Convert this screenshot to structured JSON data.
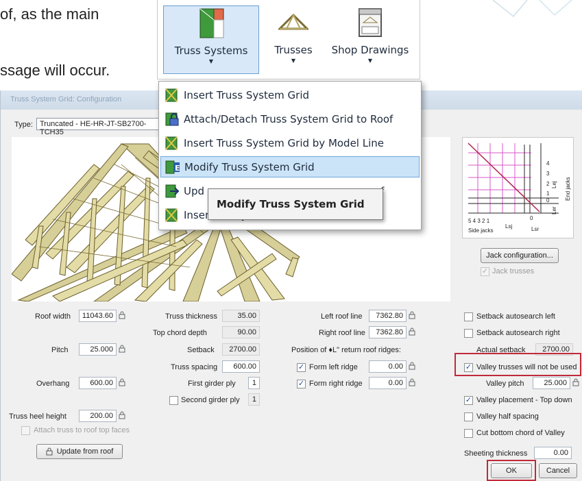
{
  "slide": {
    "line1": "of, as the main",
    "line2": "ssage will occur."
  },
  "ribbon": {
    "buttons": [
      {
        "label": "Truss Systems",
        "icon": "truss-systems-icon",
        "caret": "▼"
      },
      {
        "label": "Trusses",
        "icon": "trusses-icon",
        "caret": "▼"
      },
      {
        "label": "Shop Drawings",
        "icon": "shop-drawings-icon",
        "caret": "▼"
      }
    ]
  },
  "menu": {
    "items": [
      {
        "label": "Insert Truss System Grid"
      },
      {
        "label": "Attach/Detach Truss System Grid to Roof"
      },
      {
        "label": "Insert Truss System Grid by Model Line"
      },
      {
        "label": "Modify Truss System Grid"
      },
      {
        "label": "Upd"
      },
      {
        "label": "Insert Valley Set Grid"
      }
    ],
    "tail_text": "of",
    "tooltip": "Modify Truss System Grid"
  },
  "dialog": {
    "title": "Truss System Grid: Configuration",
    "type_label": "Type:",
    "type_value": "Truncated - HE-HR-JT-SB2700-TCH35",
    "diagram": {
      "side_ticks": "5  4  3  2  1",
      "side_jacks": "Side jacks",
      "lsj": "Lsj",
      "lsr": "Lsr",
      "end_jacks": "End jacks",
      "end_ticks": [
        "4",
        "3",
        "2",
        "1",
        "0"
      ],
      "lej": "Lej",
      "ler": "Ler",
      "zero_bottom": "0"
    },
    "jack_config_button": "Jack configuration...",
    "jack_trusses": "Jack trusses",
    "col1": {
      "roof_width_label": "Roof width",
      "roof_width": "11043.60",
      "pitch_label": "Pitch",
      "pitch": "25.000",
      "overhang_label": "Overhang",
      "overhang": "600.00",
      "heel_label": "Truss heel height",
      "heel": "200.00",
      "attach_label": "Attach truss to roof top faces",
      "update_button": "Update from roof"
    },
    "col2": {
      "thickness_label": "Truss thickness",
      "thickness": "35.00",
      "top_chord_label": "Top chord depth",
      "top_chord": "90.00",
      "setback_label": "Setback",
      "setback": "2700.00",
      "spacing_label": "Truss spacing",
      "spacing": "600.00",
      "girder_label": "First girder ply",
      "girder": "1",
      "second_girder_label": "Second girder ply",
      "second_girder": "1"
    },
    "col3": {
      "left_roof_label": "Left roof line",
      "left_roof": "7362.80",
      "right_roof_label": "Right roof line",
      "right_roof": "7362.80",
      "position_label": "Position of ♦L\" return roof ridges:",
      "form_left_label": "Form left ridge",
      "form_left": "0.00",
      "form_right_label": "Form right ridge",
      "form_right": "0.00"
    },
    "col4": {
      "setback_left": "Setback autosearch left",
      "setback_right": "Setback autosearch right",
      "actual_setback_label": "Actual setback",
      "actual_setback": "2700.00",
      "valley_not_used": "Valley trusses will not be used",
      "valley_pitch_label": "Valley pitch",
      "valley_pitch": "25.000",
      "valley_top_down": "Valley placement - Top down",
      "valley_half": "Valley half spacing",
      "cut_bottom": "Cut bottom chord of Valley",
      "sheeting_label": "Sheeting thickness",
      "sheeting": "0.00"
    },
    "ok": "OK",
    "cancel": "Cancel"
  },
  "colors": {
    "highlight": "#cce4f7",
    "accent_red": "#c0293a",
    "diagram_pink": "#d957c8"
  }
}
